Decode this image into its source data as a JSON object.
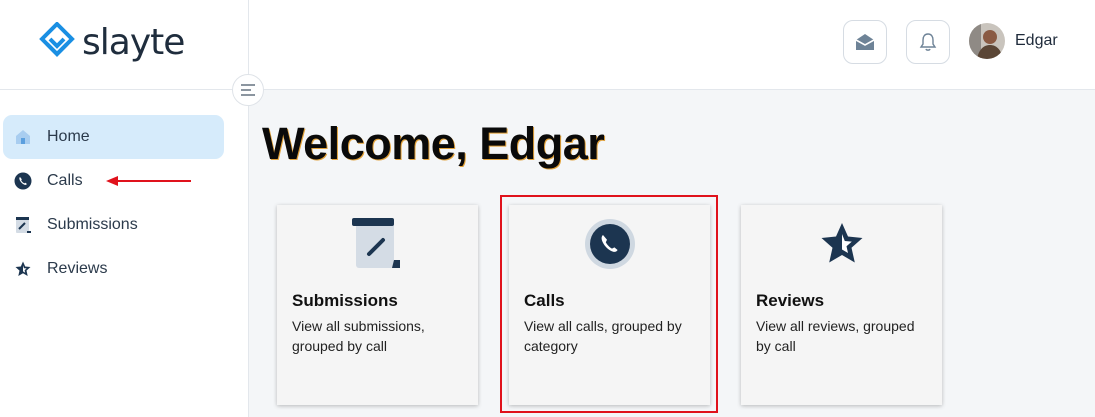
{
  "app": {
    "name": "slayte"
  },
  "sidebar": {
    "items": [
      {
        "label": "Home",
        "icon": "home-icon",
        "active": true
      },
      {
        "label": "Calls",
        "icon": "phone-icon",
        "active": false
      },
      {
        "label": "Submissions",
        "icon": "submission-icon",
        "active": false
      },
      {
        "label": "Reviews",
        "icon": "star-icon",
        "active": false
      }
    ]
  },
  "header": {
    "user_name": "Edgar"
  },
  "main": {
    "welcome": "Welcome, Edgar",
    "cards": [
      {
        "title": "Submissions",
        "description": "View all submissions, grouped by call",
        "icon": "submission-icon"
      },
      {
        "title": "Calls",
        "description": "View all calls, grouped by category",
        "icon": "phone-icon"
      },
      {
        "title": "Reviews",
        "description": "View all reviews, grouped by call",
        "icon": "star-icon"
      }
    ]
  },
  "colors": {
    "accent": "#d6ebfb",
    "icon_dark": "#1c3550",
    "highlight": "#e0121c",
    "logo_blue": "#1a8fe3"
  }
}
